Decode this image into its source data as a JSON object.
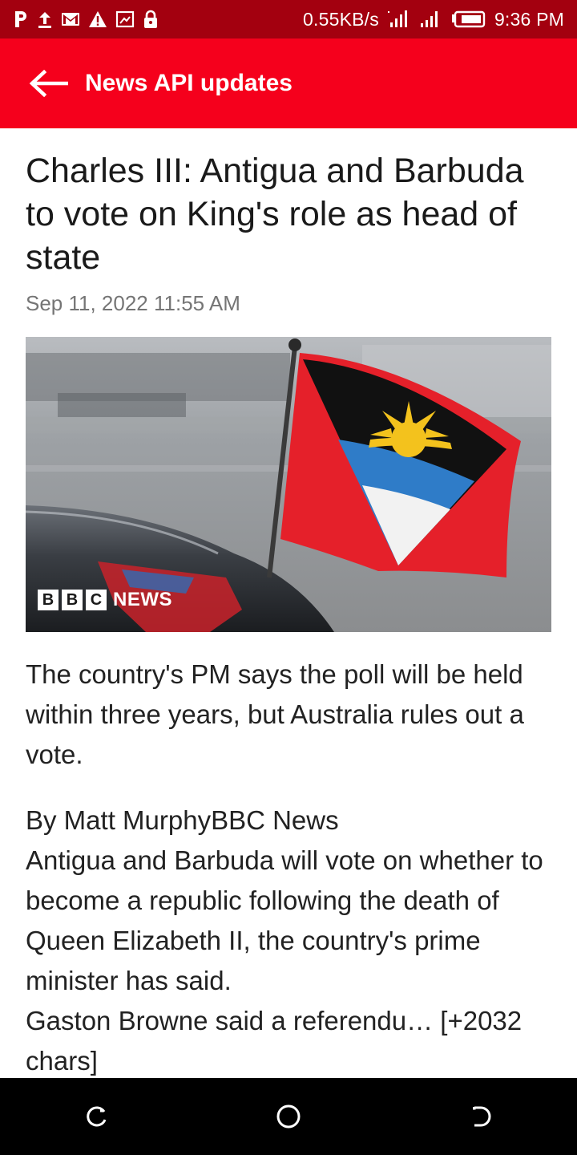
{
  "status_bar": {
    "speed": "0.55KB/s",
    "time": "9:36 PM",
    "left_icons": [
      "p-icon",
      "upload-icon",
      "gmail-icon",
      "warning-icon",
      "screenshot-icon",
      "lock-icon"
    ],
    "right_icons": [
      "signal-icon",
      "signal-icon",
      "battery-icon"
    ]
  },
  "app_bar": {
    "title": "News API updates",
    "back_icon": "arrow-left-icon"
  },
  "article": {
    "headline": "Charles III: Antigua and Barbuda to vote on King's role as head of state",
    "date": "Sep 11, 2022 11:55 AM",
    "image_logo": {
      "b1": "B",
      "b2": "B",
      "c": "C",
      "news": "NEWS"
    },
    "description": "The country's PM says the poll will be held within three years, but Australia rules out a vote.",
    "byline": "By Matt MurphyBBC News",
    "body": "Antigua and Barbuda will vote on whether to become a republic following the death of Queen Elizabeth II, the country's prime minister has said.",
    "body2": "Gaston Browne said a referendu… [+2032 chars]"
  },
  "nav_bar": {
    "buttons": [
      "recents-icon",
      "home-icon",
      "back-icon"
    ]
  },
  "colors": {
    "status_bar": "#a3000f",
    "app_bar": "#f5001c",
    "nav_bar": "#000000"
  }
}
